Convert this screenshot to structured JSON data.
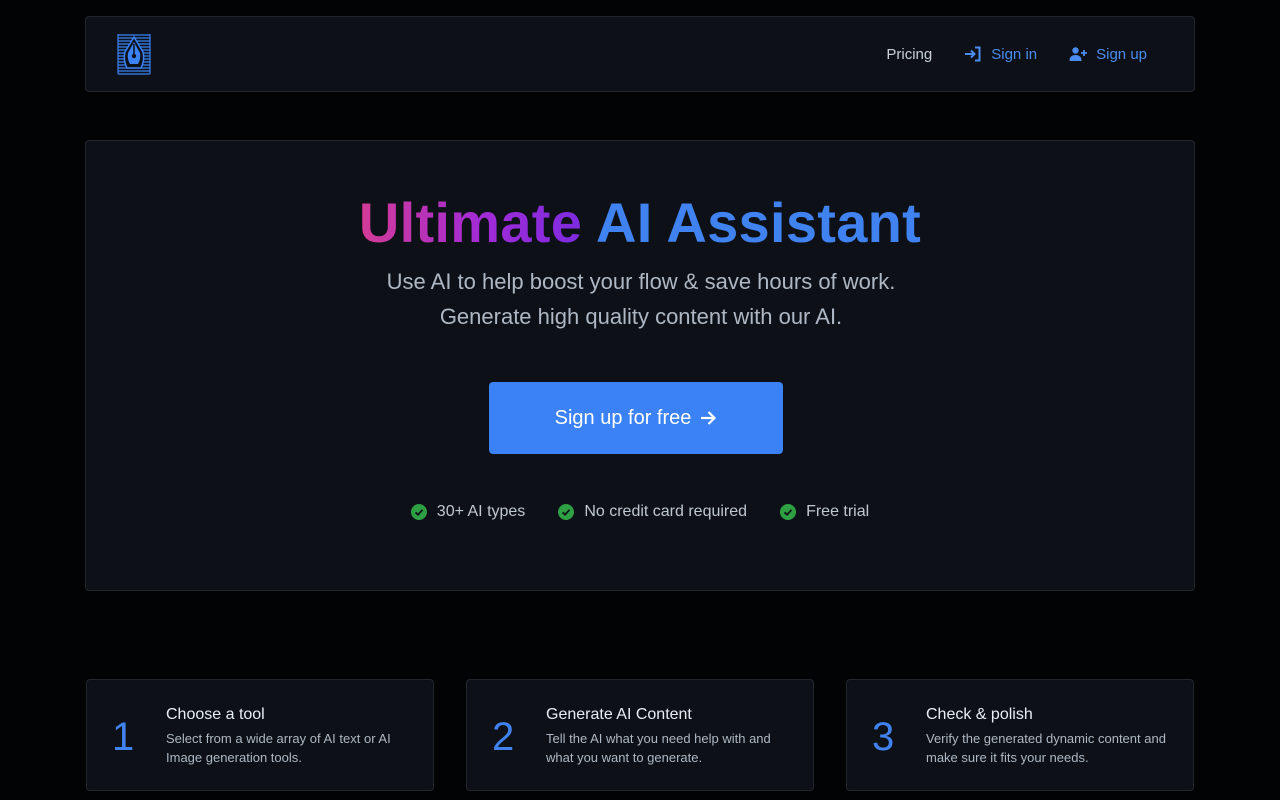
{
  "nav": {
    "logo_icon": "pen-nib-logo-icon",
    "pricing": "Pricing",
    "sign_in": "Sign in",
    "sign_up": "Sign up"
  },
  "hero": {
    "title_part1": "Ultimate",
    "title_part2": "AI Assistant",
    "subtitle": "Use AI to help boost your flow & save hours of work. Generate high quality content with our AI.",
    "cta_label": "Sign up for free",
    "features": [
      "30+ AI types",
      "No credit card required",
      "Free trial"
    ]
  },
  "steps": [
    {
      "number": "1",
      "title": "Choose a tool",
      "description": "Select from a wide array of AI text or AI Image generation tools."
    },
    {
      "number": "2",
      "title": "Generate AI Content",
      "description": "Tell the AI what you need help with and what you want to generate."
    },
    {
      "number": "3",
      "title": "Check & polish",
      "description": "Verify the generated dynamic content and make sure it fits your needs."
    }
  ],
  "colors": {
    "accent": "#3b82f6",
    "gradient_start": "#d43b96",
    "gradient_end": "#7d2be0",
    "check_green": "#2ea043",
    "background": "#020304",
    "panel": "#0d1117"
  }
}
